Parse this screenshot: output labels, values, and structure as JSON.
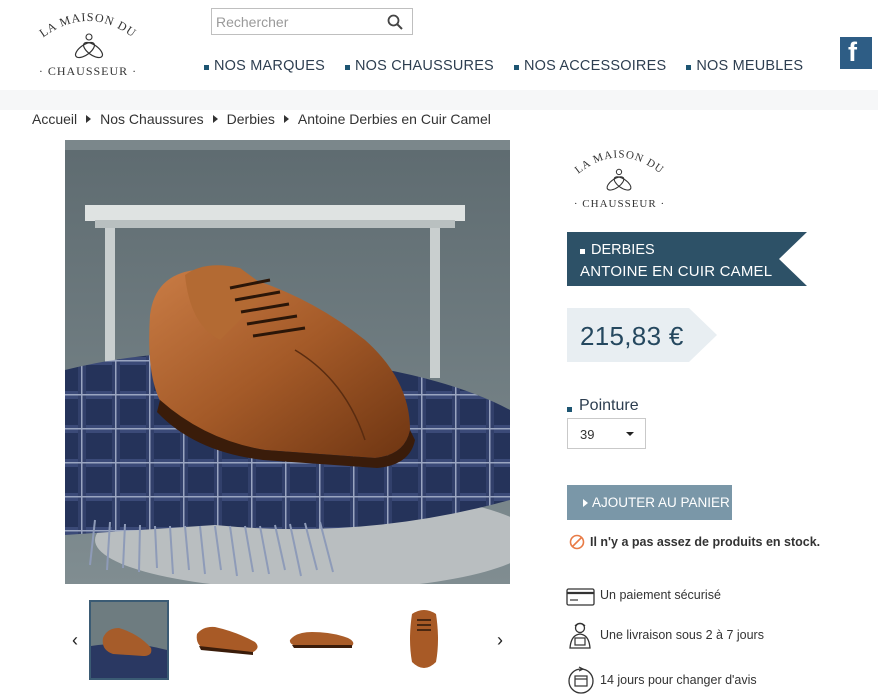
{
  "header": {
    "logo": {
      "top": "LA MAISON DU",
      "bottom": "· CHAUSSEUR ·"
    },
    "search": {
      "placeholder": "Rechercher",
      "icon": "magnifier-icon"
    },
    "nav": [
      {
        "label": "NOS MARQUES"
      },
      {
        "label": "NOS CHAUSSURES"
      },
      {
        "label": "NOS ACCESSOIRES"
      },
      {
        "label": "NOS MEUBLES"
      }
    ],
    "social": {
      "icon": "facebook-icon",
      "label": "f"
    }
  },
  "breadcrumb": [
    "Accueil",
    "Nos Chaussures",
    "Derbies",
    "Antoine Derbies en Cuir Camel"
  ],
  "product": {
    "brand_logo": {
      "top": "LA MAISON DU",
      "bottom": "· CHAUSSEUR ·"
    },
    "category": "DERBIES",
    "name": "ANTOINE EN CUIR CAMEL",
    "price": "215,83 €",
    "size_label": "Pointure",
    "size_value": "39",
    "add_to_cart": "AJOUTER AU PANIER",
    "stock_message": "Il n'y a pas assez de produits en stock.",
    "features": [
      {
        "icon": "credit-card-icon",
        "label": "Un paiement sécurisé"
      },
      {
        "icon": "delivery-person-icon",
        "label": "Une livraison sous 2 à 7 jours"
      },
      {
        "icon": "return-calendar-icon",
        "label": "14 jours pour changer d'avis"
      }
    ]
  },
  "gallery": {
    "prev_icon": "chevron-left-icon",
    "next_icon": "chevron-right-icon",
    "prev_label": "‹",
    "next_label": "›"
  },
  "colors": {
    "accent": "#1d5572",
    "ribbon": "#2d5167",
    "price_bg": "#e8eef2",
    "button": "#7a97a8",
    "facebook": "#2e5d85",
    "warning": "#e87b46"
  }
}
